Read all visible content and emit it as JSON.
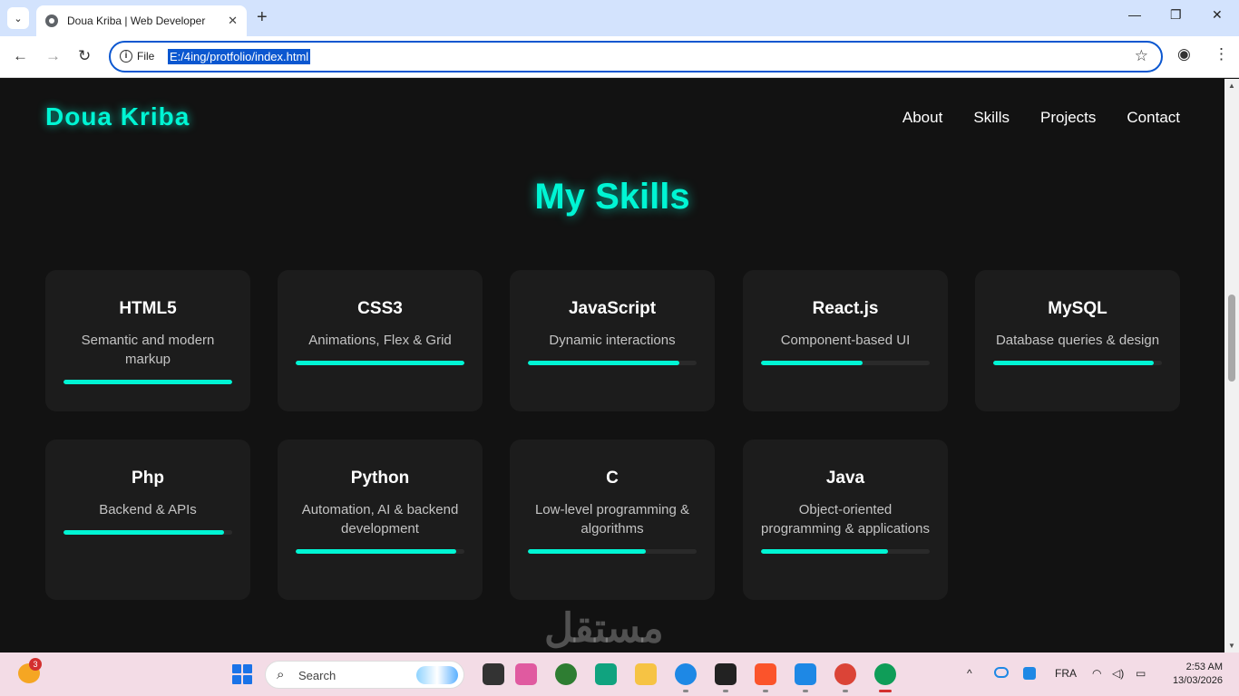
{
  "browser": {
    "tab_title": "Doua Kriba | Web Developer",
    "tab_close": "✕",
    "new_tab": "+",
    "minimize": "—",
    "restore": "❐",
    "close": "✕",
    "back": "←",
    "forward": "→",
    "reload": "↻",
    "info_icon": "i",
    "file_label": "File",
    "url": "E:/4ing/protfolio/index.html",
    "bookmark_icon": "☆",
    "profile_icon": "◉",
    "menu_icon": "⋮",
    "tab_list_icon": "⌄"
  },
  "header": {
    "brand": "Doua Kriba",
    "nav": [
      "About",
      "Skills",
      "Projects",
      "Contact"
    ]
  },
  "skills": {
    "title": "My Skills",
    "items": [
      {
        "name": "HTML5",
        "desc": "Semantic and modern markup",
        "level": 100
      },
      {
        "name": "CSS3",
        "desc": "Animations, Flex & Grid",
        "level": 100
      },
      {
        "name": "JavaScript",
        "desc": "Dynamic interactions",
        "level": 90
      },
      {
        "name": "React.js",
        "desc": "Component-based UI",
        "level": 60
      },
      {
        "name": "MySQL",
        "desc": "Database queries & design",
        "level": 95
      },
      {
        "name": "Php",
        "desc": "Backend & APIs",
        "level": 95
      },
      {
        "name": "Python",
        "desc": "Automation, AI & backend development",
        "level": 95
      },
      {
        "name": "C",
        "desc": "Low-level programming & algorithms",
        "level": 70
      },
      {
        "name": "Java",
        "desc": "Object-oriented programming & applications",
        "level": 75
      }
    ]
  },
  "taskbar": {
    "search_placeholder": "Search",
    "weather_badge": "3",
    "language": "FRA",
    "time": "2:53 AM",
    "date": "13/03/2026",
    "tray_chevron": "^",
    "tray_wifi": "◠",
    "tray_volume": "◁)",
    "tray_battery": "▭",
    "apps": [
      {
        "name": "task-view",
        "color": "#333333"
      },
      {
        "name": "copilot",
        "color": "#e05aa0"
      },
      {
        "name": "chrome-alt",
        "color": "#2e7d32"
      },
      {
        "name": "chatgpt",
        "color": "#10a37f"
      },
      {
        "name": "file-explorer",
        "color": "#f6c344"
      },
      {
        "name": "edge",
        "color": "#1e88e5"
      },
      {
        "name": "github",
        "color": "#222222"
      },
      {
        "name": "brave",
        "color": "#fb542b"
      },
      {
        "name": "vscode",
        "color": "#1e88e5"
      },
      {
        "name": "chrome",
        "color": "#db4437"
      },
      {
        "name": "chrome-active",
        "color": "#0f9d58"
      }
    ]
  },
  "watermark": "مستقل"
}
